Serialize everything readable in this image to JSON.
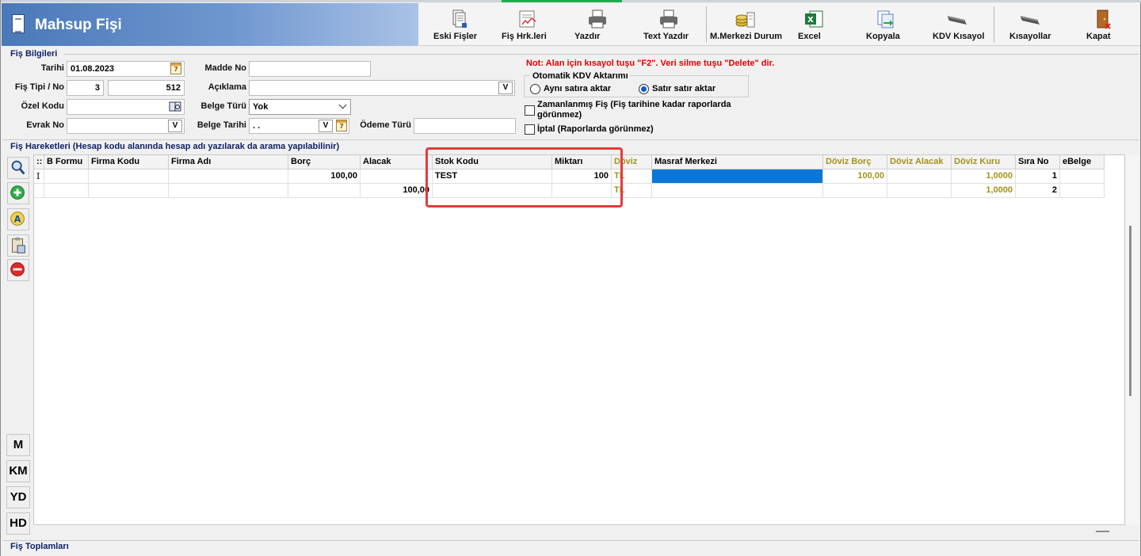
{
  "window": {
    "title": "Mahsup Fişi"
  },
  "toolbar": {
    "items": [
      {
        "label": "Eski Fişler",
        "icon": "old-vouchers-icon"
      },
      {
        "label": "Fiş Hrk.leri",
        "icon": "voucher-movements-icon"
      },
      {
        "label": "Yazdır",
        "icon": "printer-icon"
      },
      {
        "label": "Text Yazdır",
        "icon": "text-printer-icon"
      },
      {
        "label": "M.Merkezi Durum",
        "icon": "cost-center-coins-icon"
      },
      {
        "label": "Excel",
        "icon": "excel-icon"
      },
      {
        "label": "Kopyala",
        "icon": "copy-icon"
      },
      {
        "label": "KDV Kısayol",
        "icon": "kdv-keyboard-icon"
      },
      {
        "label": "Kısayollar",
        "icon": "shortcuts-keyboard-icon"
      },
      {
        "label": "Kapat",
        "icon": "exit-door-icon"
      }
    ]
  },
  "fis_bilgileri": {
    "heading": "Fiş Bilgileri",
    "tarih_label": "Tarihi",
    "tarih_value": "01.08.2023",
    "fis_tipi_label": "Fiş Tipi / No",
    "fis_tipi_value": "3",
    "fis_no_value": "512",
    "ozel_kodu_label": "Özel Kodu",
    "ozel_kodu_value": "",
    "evrak_no_label": "Evrak No",
    "evrak_no_value": "",
    "madde_no_label": "Madde No",
    "madde_no_value": "",
    "aciklama_label": "Açıklama",
    "aciklama_value": "",
    "belge_turu_label": "Belge Türü",
    "belge_turu_value": "Yok",
    "belge_tarihi_label": "Belge Tarihi",
    "belge_tarihi_value": ". .",
    "odeme_turu_label": "Ödeme Türü",
    "odeme_turu_value": "",
    "v_button": "V",
    "note": "Not: Alan için kısayol tuşu \"F2\". Veri silme tuşu \"Delete\" dir.",
    "kdv_group_title": "Otomatik KDV Aktarımı",
    "kdv_option1": "Aynı satıra aktar",
    "kdv_option2": "Satır satır aktar",
    "kdv_selected": "Satır satır aktar",
    "zamanlanmis_label": "Zamanlanmış Fiş (Fiş tarihine kadar raporlarda görünmez)",
    "iptal_label": "İptal (Raporlarda görünmez)"
  },
  "fis_hareketleri": {
    "heading": "Fiş Hareketleri (Hesap kodu alanında hesap adı yazılarak da arama yapılabilinir)",
    "columns": [
      "::",
      "B Formu",
      "Firma Kodu",
      "Firma Adı",
      "Borç",
      "Alacak",
      "Stok Kodu",
      "Miktarı",
      "Döviz",
      "Masraf Merkezi",
      "Döviz Borç",
      "Döviz Alacak",
      "Döviz Kuru",
      "Sıra No",
      "eBelge"
    ],
    "rows": [
      {
        "marker": "I",
        "b_formu": "",
        "firma_kodu": "",
        "firma_adi": "",
        "borc": "100,00",
        "alacak": "",
        "stok_kodu": "TEST",
        "miktari": "100",
        "doviz": "TL",
        "masraf_merkezi": "",
        "doviz_borc": "100,00",
        "doviz_alacak": "",
        "doviz_kuru": "1,0000",
        "sira_no": "1",
        "ebelge": ""
      },
      {
        "marker": "",
        "b_formu": "",
        "firma_kodu": "",
        "firma_adi": "",
        "borc": "",
        "alacak": "100,00",
        "stok_kodu": "",
        "miktari": "",
        "doviz": "TL",
        "masraf_merkezi": "",
        "doviz_borc": "",
        "doviz_alacak": "",
        "doviz_kuru": "1,0000",
        "sira_no": "2",
        "ebelge": ""
      }
    ]
  },
  "side_buttons": {
    "icons": [
      "search-icon",
      "add-icon",
      "accounting-icon",
      "clipboard-icon",
      "delete-icon"
    ],
    "text_buttons": [
      "M",
      "KM",
      "YD",
      "HD"
    ]
  },
  "fis_toplamlari": {
    "heading": "Fiş Toplamları"
  },
  "colors": {
    "accent_blue": "#4a78b8",
    "header_gold": "#a39219",
    "note_red": "#e00000",
    "selection_blue": "#0a77d8",
    "highlight_red": "#e33b3b"
  }
}
